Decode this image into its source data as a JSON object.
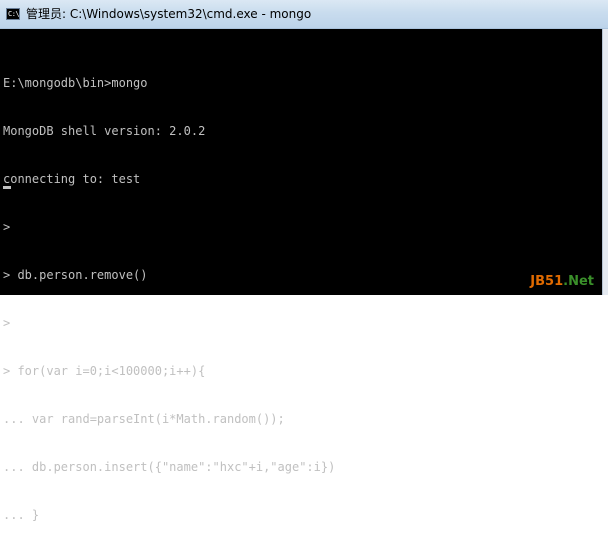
{
  "window": {
    "title": "管理员: C:\\Windows\\system32\\cmd.exe - mongo",
    "icon_text": "C:\\"
  },
  "console": {
    "lines": [
      "E:\\mongodb\\bin>mongo",
      "MongoDB shell version: 2.0.2",
      "connecting to: test",
      ">",
      "> db.person.remove()",
      ">",
      "> for(var i=0;i<100000;i++){",
      "... var rand=parseInt(i*Math.random());",
      "... db.person.insert({\"name\":\"hxc\"+i,\"age\":i})",
      "... }"
    ]
  },
  "watermark": {
    "part1": "JB51",
    "part2": ".Net"
  }
}
